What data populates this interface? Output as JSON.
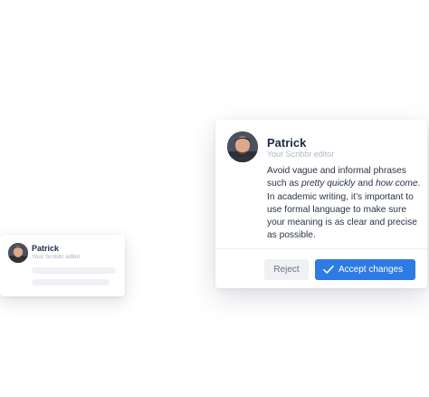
{
  "mini_card": {
    "name": "Patrick",
    "role": "Your Scribbr editor"
  },
  "comment_card": {
    "author": "Patrick",
    "role": "Your Scribbr editor",
    "message": {
      "part1": "Avoid vague and informal phrases such as ",
      "em1": "pretty quickly",
      "part2": " and ",
      "em2": "how come",
      "part3": ". In academic writing, it’s important to use formal language to make sure your meaning is as clear and precise as possible."
    },
    "actions": {
      "reject_label": "Reject",
      "accept_label": "Accept changes"
    }
  },
  "colors": {
    "accent": "#2f7be5",
    "reject_bg": "#f0f1f4",
    "name_text": "#1f2a44",
    "role_text": "#b0b6c5"
  },
  "icons": {
    "avatar": "avatar",
    "accept": "check-icon"
  }
}
